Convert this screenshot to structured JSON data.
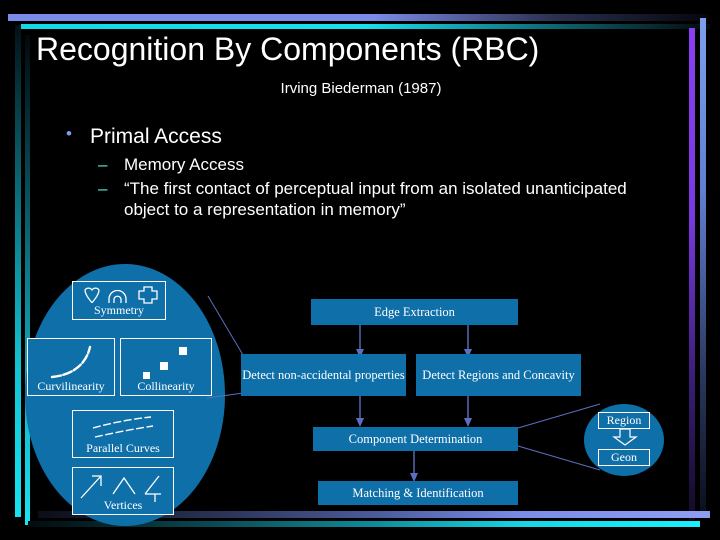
{
  "slide": {
    "title": "Recognition By Components (RBC)",
    "subtitle": "Irving Biederman (1987)",
    "bullets": {
      "level1": "Primal Access",
      "level2": [
        "Memory Access",
        "“The first contact of perceptual input from an isolated unanticipated object to a representation in memory”"
      ]
    }
  },
  "colors": {
    "background": "#000000",
    "box_blue": "#0f6fa8",
    "text_white": "#ffffff",
    "bullet_blue": "#7b9ce8",
    "dash_cyan": "#5de8d8",
    "accent_top_bar": "#7b8ce8",
    "accent_cyan_bar": "#18e0ee",
    "accent_purple_bar": "#8a3ff0",
    "connector": "#5b6fc0"
  },
  "diagram": {
    "feature_boxes": [
      {
        "label": "Symmetry",
        "icons": [
          "heart-outline-icon",
          "arch-outline-icon",
          "cross-outline-icon"
        ]
      },
      {
        "label": "Curvilinearity",
        "icons": [
          "curved-line-icon"
        ]
      },
      {
        "label": "Collinearity",
        "icons": [
          "three-dots-diagonal-icon"
        ]
      },
      {
        "label": "Parallel Curves",
        "icons": [
          "parallel-curves-icon"
        ]
      },
      {
        "label": "Vertices",
        "icons": [
          "arrow-vertex-icon",
          "peak-vertex-icon",
          "y-vertex-icon"
        ]
      }
    ],
    "process_boxes": [
      {
        "label": "Edge Extraction"
      },
      {
        "label": "Detect non-accidental properties"
      },
      {
        "label": "Detect Regions and Concavity"
      },
      {
        "label": "Component Determination"
      },
      {
        "label": "Matching & Identification"
      }
    ],
    "callout": {
      "items": [
        "Region",
        "Geon"
      ],
      "arrow": "down-arrow-icon"
    }
  }
}
